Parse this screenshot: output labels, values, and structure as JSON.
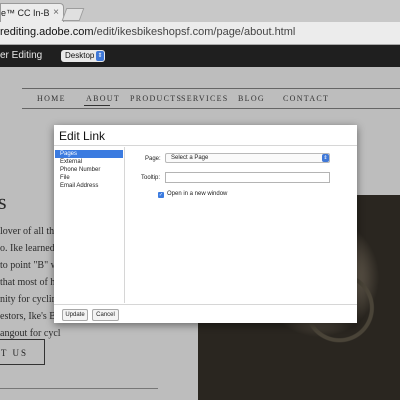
{
  "browser": {
    "tab_title": "e™ CC In-Br",
    "url_host": "rediting.adobe.com",
    "url_path": "/edit/ikesbikeshopsf.com/page/about.html"
  },
  "toolbar": {
    "title": "er Editing",
    "view_select": "Desktop"
  },
  "site": {
    "nav": [
      "HOME",
      "ABOUT",
      "PRODUCTS",
      "SERVICES",
      "BLOG",
      "CONTACT"
    ],
    "heading_fragment": "s",
    "body_lines": [
      "lover of all th",
      "o. Ike learned a",
      "to point \"B\" w",
      "that most of h",
      "nity for cycling",
      "estors, Ike's Bik",
      "angout for cycl"
    ],
    "contact_button": "T US"
  },
  "dialog": {
    "title": "Edit Link",
    "link_types": [
      "Pages",
      "External",
      "Phone Number",
      "File",
      "Email Address"
    ],
    "page_label": "Page:",
    "page_select": "Select a Page",
    "tooltip_label": "Tooltip:",
    "tooltip_value": "",
    "new_window_label": "Open in a new window",
    "new_window_checked": true,
    "update_button": "Update",
    "cancel_button": "Cancel"
  },
  "colors": {
    "accent": "#3b7be0",
    "toolbar_bg": "#1f1f1f",
    "site_bg": "#bdbdbd"
  }
}
